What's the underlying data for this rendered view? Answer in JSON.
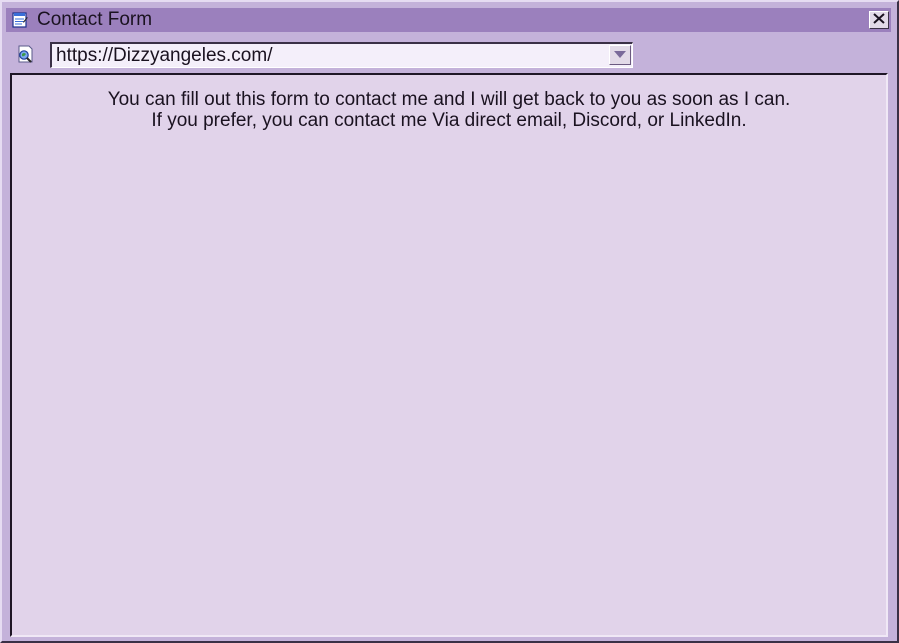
{
  "window": {
    "title": "Contact Form",
    "title_icon": "notepad-icon",
    "close_icon": "close-icon",
    "colors": {
      "titlebar": "#9b80bd",
      "frame": "#c4b2da",
      "content_bg": "#e1d3ea",
      "address_bg": "#f4effa"
    }
  },
  "addressbar": {
    "icon": "globe-search-icon",
    "url": "https://Dizzyangeles.com/",
    "dropdown_icon": "triangle-down-icon"
  },
  "content": {
    "line1": "You can fill out this form to contact me and I will get back to you as soon as I can.",
    "line2": "If you prefer, you can contact me Via direct email, Discord, or LinkedIn."
  }
}
